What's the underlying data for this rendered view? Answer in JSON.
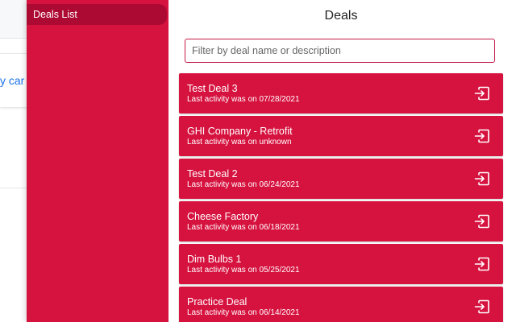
{
  "host": {
    "link_fragment": "y car"
  },
  "sidebar": {
    "items": [
      {
        "label": "Deals List"
      }
    ]
  },
  "main": {
    "title": "Deals",
    "filter": {
      "placeholder": "Filter by deal name or description",
      "value": ""
    },
    "deals": [
      {
        "name": "Test Deal 3",
        "activity": "Last activity was on 07/28/2021"
      },
      {
        "name": "GHI Company - Retrofit",
        "activity": "Last activity was on unknown"
      },
      {
        "name": "Test Deal 2",
        "activity": "Last activity was on 06/24/2021"
      },
      {
        "name": "Cheese Factory",
        "activity": "Last activity was on 06/18/2021"
      },
      {
        "name": "Dim Bulbs 1",
        "activity": "Last activity was on 05/25/2021"
      },
      {
        "name": "Practice Deal",
        "activity": "Last activity was on 06/14/2021"
      }
    ]
  },
  "colors": {
    "brand": "#d6123f",
    "sidebar_active": "#ad0a33",
    "link": "#1a73e8"
  },
  "icons": {
    "deal_open": "open-in-icon"
  }
}
